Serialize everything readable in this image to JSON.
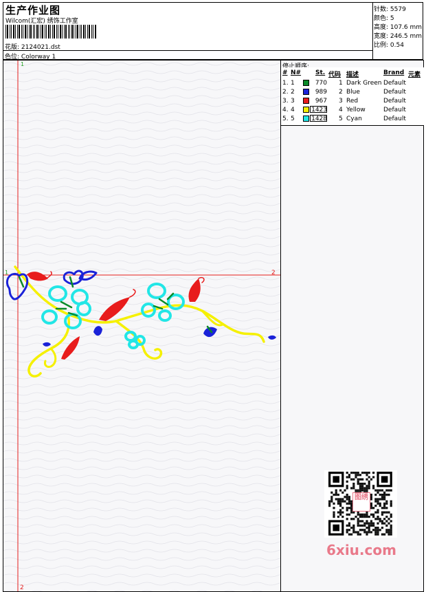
{
  "header": {
    "title": "生产作业图",
    "subtitle": "Wilcom(汇宏) 绣饰工作室",
    "design_label": "花版:",
    "design_value": "2124021.dst",
    "color_label": "色位:",
    "color_value": "Colorway 1"
  },
  "stats": {
    "stitches": "针数: 5579",
    "colors": "颜色: 5",
    "height": "高度: 107.6 mm",
    "width": "宽度: 246.5 mm",
    "scale": "比例: 0.54"
  },
  "markers": {
    "top": "1",
    "left": "1",
    "right": "2",
    "bottom": "2"
  },
  "stop_sequence": {
    "title": "停止顺序:",
    "headers": [
      "#",
      "N#",
      "St.",
      "代码",
      "描述",
      "Brand",
      "元素"
    ],
    "rows": [
      {
        "idx": "1.",
        "n": "1",
        "color": "#0a8a28",
        "st": "770",
        "code": "1",
        "desc": "Dark Green",
        "brand": "Default"
      },
      {
        "idx": "2.",
        "n": "2",
        "color": "#1a22d8",
        "st": "989",
        "code": "2",
        "desc": "Blue",
        "brand": "Default"
      },
      {
        "idx": "3.",
        "n": "3",
        "color": "#e81c1c",
        "st": "967",
        "code": "3",
        "desc": "Red",
        "brand": "Default"
      },
      {
        "idx": "4.",
        "n": "4",
        "color": "#f5f000",
        "st": "1423",
        "code": "4",
        "desc": "Yellow",
        "brand": "Default"
      },
      {
        "idx": "5.",
        "n": "5",
        "color": "#22e6e6",
        "st": "1428",
        "code": "5",
        "desc": "Cyan",
        "brand": "Default"
      }
    ]
  },
  "watermark": "6xiu.com",
  "qr_badge": "图绣"
}
